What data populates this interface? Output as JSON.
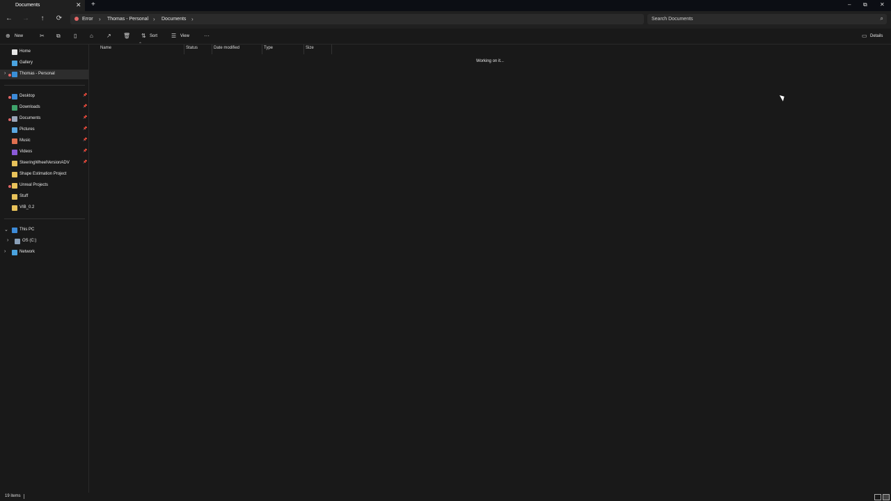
{
  "tab": {
    "title": "Documents",
    "close": "✕",
    "new": "+"
  },
  "window": {
    "minimize": "–",
    "restore": "⧉",
    "close": "✕"
  },
  "nav": {
    "back": "←",
    "forward": "→",
    "up": "↑",
    "refresh": "⟳"
  },
  "breadcrumb": {
    "status": "Error",
    "items": [
      "Thomas - Personal",
      "Documents"
    ],
    "sep": "›"
  },
  "search": {
    "placeholder": "Search Documents",
    "icon": "⌕"
  },
  "toolbar": {
    "new": "New",
    "sort": "Sort",
    "view": "View",
    "more": "···",
    "details": "Details",
    "icons": {
      "new": "⊕",
      "cut": "✂",
      "copy": "⧉",
      "paste": "▯",
      "rename": "⌂",
      "share": "↗",
      "delete": "🗑",
      "sort": "⇅",
      "view": "☰",
      "details": "▭"
    }
  },
  "sidebar": {
    "quick": [
      {
        "label": "Home",
        "color": "#e6e6e6"
      },
      {
        "label": "Gallery",
        "color": "#4aa3df"
      },
      {
        "label": "Thomas - Personal",
        "color": "#3a8fd6"
      }
    ],
    "pinned": [
      {
        "label": "Desktop",
        "color": "#3d8bd8"
      },
      {
        "label": "Downloads",
        "color": "#3ea36b"
      },
      {
        "label": "Documents",
        "color": "#9aa5b8"
      },
      {
        "label": "Pictures",
        "color": "#5aa7e0"
      },
      {
        "label": "Music",
        "color": "#e07050"
      },
      {
        "label": "Videos",
        "color": "#8a5ad8"
      },
      {
        "label": "SteeringWheelVersionADV",
        "color": "#e8c25a"
      },
      {
        "label": "Shape Estimation Project",
        "color": "#e8c25a"
      },
      {
        "label": "Unreal Projects",
        "color": "#e8c25a"
      },
      {
        "label": "Stuff",
        "color": "#e8c25a"
      },
      {
        "label": "VIB_0.2",
        "color": "#e8c25a"
      }
    ],
    "this_pc": "This PC",
    "drive": "OS (C:)",
    "network": "Network"
  },
  "columns": [
    "Name",
    "Status",
    "Date modified",
    "Type",
    "Size"
  ],
  "content": {
    "working": "Working on it..."
  },
  "statusbar": {
    "items": "19 items"
  }
}
